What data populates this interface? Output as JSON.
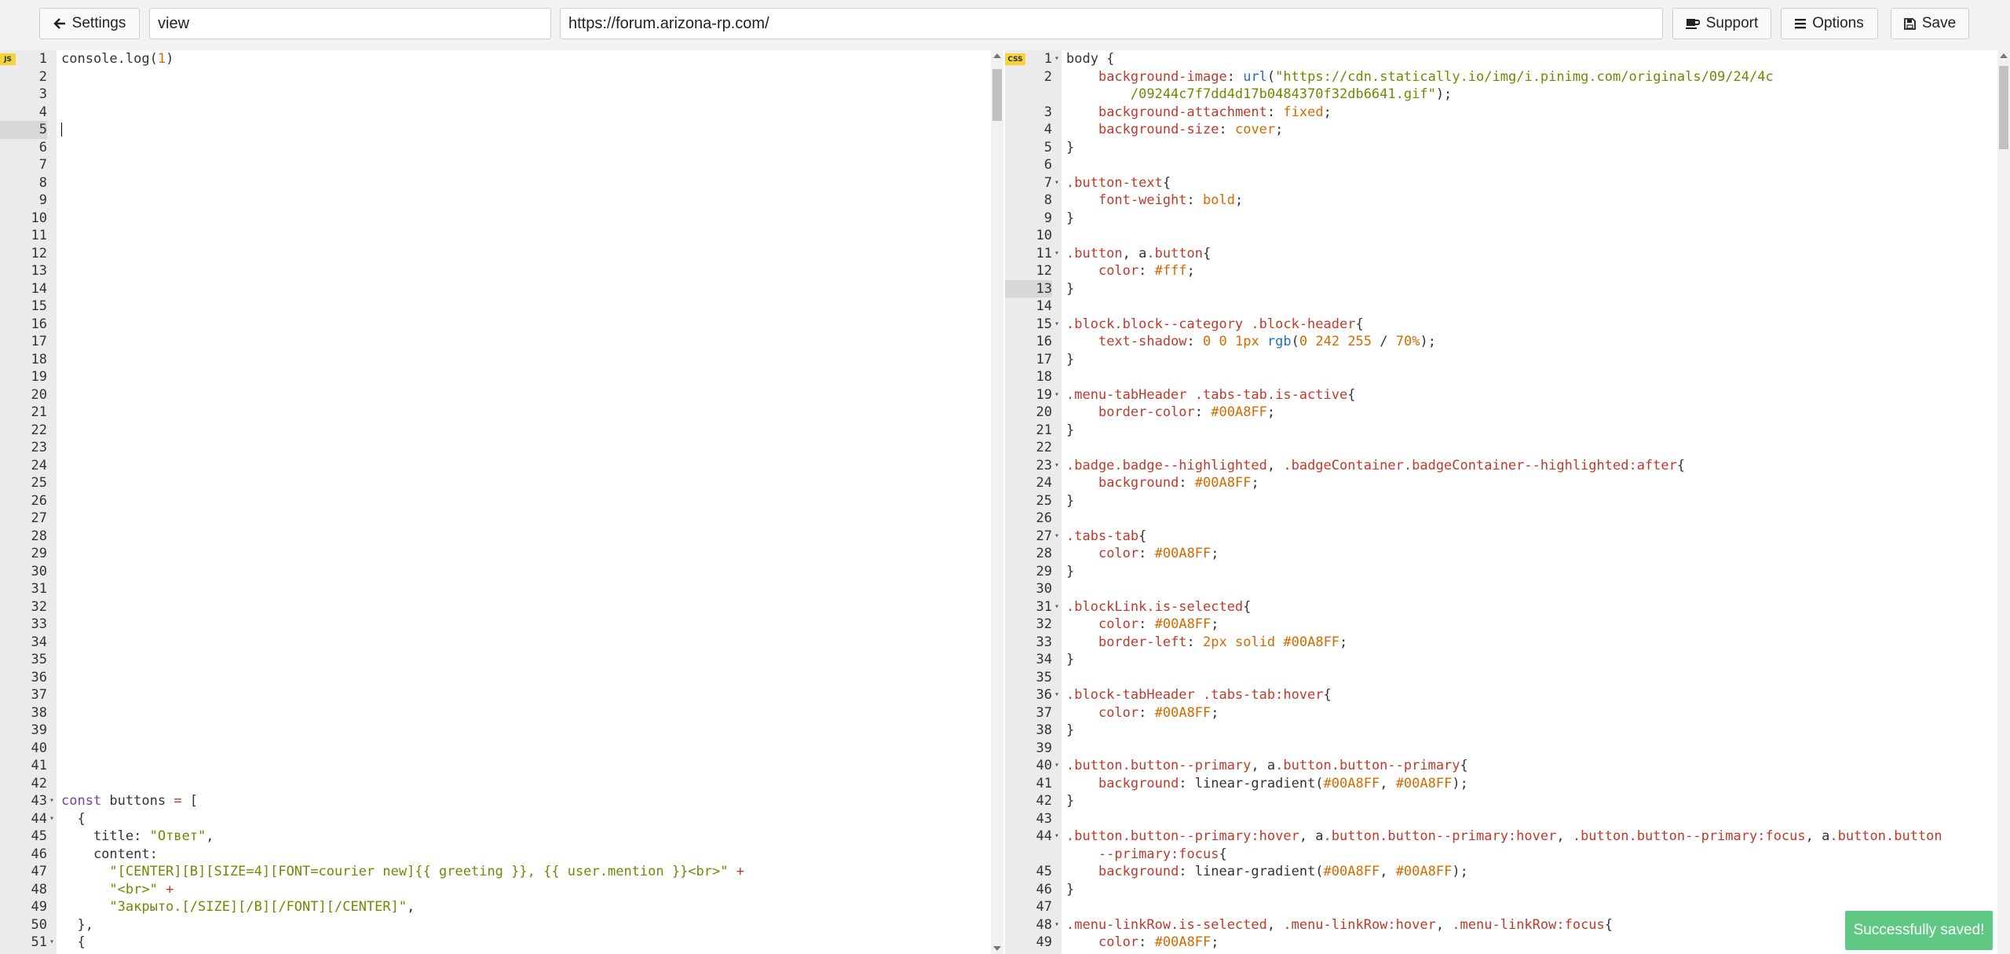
{
  "toolbar": {
    "settings_label": "Settings",
    "view_value": "view",
    "url_value": "https://forum.arizona-rp.com/",
    "support_label": "Support",
    "options_label": "Options",
    "save_label": "Save"
  },
  "js_editor": {
    "badge": "JS",
    "active_line": 5,
    "lines": [
      {
        "n": "1",
        "t": [
          [
            "console.log(",
            "t-plain"
          ],
          [
            "1",
            "t-num"
          ],
          [
            ")",
            "t-plain"
          ]
        ]
      },
      {
        "n": "2",
        "t": []
      },
      {
        "n": "3",
        "t": []
      },
      {
        "n": "4",
        "t": []
      },
      {
        "n": "5",
        "t": [],
        "cursor": true
      },
      {
        "n": "6",
        "t": []
      },
      {
        "n": "7",
        "t": []
      },
      {
        "n": "8",
        "t": []
      },
      {
        "n": "9",
        "t": []
      },
      {
        "n": "10",
        "t": []
      },
      {
        "n": "11",
        "t": []
      },
      {
        "n": "12",
        "t": []
      },
      {
        "n": "13",
        "t": []
      },
      {
        "n": "14",
        "t": []
      },
      {
        "n": "15",
        "t": []
      },
      {
        "n": "16",
        "t": []
      },
      {
        "n": "17",
        "t": []
      },
      {
        "n": "18",
        "t": []
      },
      {
        "n": "19",
        "t": []
      },
      {
        "n": "20",
        "t": []
      },
      {
        "n": "21",
        "t": []
      },
      {
        "n": "22",
        "t": []
      },
      {
        "n": "23",
        "t": []
      },
      {
        "n": "24",
        "t": []
      },
      {
        "n": "25",
        "t": []
      },
      {
        "n": "26",
        "t": []
      },
      {
        "n": "27",
        "t": []
      },
      {
        "n": "28",
        "t": []
      },
      {
        "n": "29",
        "t": []
      },
      {
        "n": "30",
        "t": []
      },
      {
        "n": "31",
        "t": []
      },
      {
        "n": "32",
        "t": []
      },
      {
        "n": "33",
        "t": []
      },
      {
        "n": "34",
        "t": []
      },
      {
        "n": "35",
        "t": []
      },
      {
        "n": "36",
        "t": []
      },
      {
        "n": "37",
        "t": []
      },
      {
        "n": "38",
        "t": []
      },
      {
        "n": "39",
        "t": []
      },
      {
        "n": "40",
        "t": []
      },
      {
        "n": "41",
        "t": []
      },
      {
        "n": "42",
        "t": []
      },
      {
        "n": "43",
        "fold": true,
        "t": [
          [
            "const",
            "t-kw"
          ],
          [
            " buttons ",
            "t-plain"
          ],
          [
            "=",
            "t-op"
          ],
          [
            " [",
            "t-plain"
          ]
        ]
      },
      {
        "n": "44",
        "fold": true,
        "t": [
          [
            "  {",
            "t-plain"
          ]
        ]
      },
      {
        "n": "45",
        "t": [
          [
            "    title: ",
            "t-plain"
          ],
          [
            "\"Ответ\"",
            "t-str"
          ],
          [
            ",",
            "t-plain"
          ]
        ]
      },
      {
        "n": "46",
        "t": [
          [
            "    content:",
            "t-plain"
          ]
        ]
      },
      {
        "n": "47",
        "t": [
          [
            "      \"[CENTER][B][SIZE=4][FONT=courier new]{{ greeting }}, {{ user.mention }}<br>\"",
            "t-str"
          ],
          [
            " +",
            "t-op"
          ]
        ]
      },
      {
        "n": "48",
        "t": [
          [
            "      \"<br>\"",
            "t-str"
          ],
          [
            " +",
            "t-op"
          ]
        ]
      },
      {
        "n": "49",
        "t": [
          [
            "      \"Закрыто.[/SIZE][/B][/FONT][/CENTER]\"",
            "t-str"
          ],
          [
            ",",
            "t-plain"
          ]
        ]
      },
      {
        "n": "50",
        "t": [
          [
            "  },",
            "t-plain"
          ]
        ]
      },
      {
        "n": "51",
        "fold": true,
        "t": [
          [
            "  {",
            "t-plain"
          ]
        ]
      }
    ]
  },
  "css_editor": {
    "badge": "CSS",
    "active_line": 13,
    "lines": [
      {
        "n": "1",
        "fold": true,
        "t": [
          [
            "body {",
            "t-plain"
          ]
        ]
      },
      {
        "n": "2",
        "t": [
          [
            "    ",
            "t-plain"
          ],
          [
            "background-image",
            "t-prop"
          ],
          [
            ": ",
            "t-plain"
          ],
          [
            "url",
            "t-url"
          ],
          [
            "(",
            "t-plain"
          ],
          [
            "\"https://cdn.statically.io/img/i.pinimg.com/originals/09/24/4c",
            "t-str"
          ]
        ]
      },
      {
        "n": "",
        "t": [
          [
            "        /09244c7f7dd4d17b0484370f32db6641.gif\"",
            "t-str"
          ],
          [
            ");",
            "t-plain"
          ]
        ]
      },
      {
        "n": "3",
        "t": [
          [
            "    ",
            "t-plain"
          ],
          [
            "background-attachment",
            "t-prop"
          ],
          [
            ": ",
            "t-plain"
          ],
          [
            "fixed",
            "t-val"
          ],
          [
            ";",
            "t-plain"
          ]
        ]
      },
      {
        "n": "4",
        "t": [
          [
            "    ",
            "t-plain"
          ],
          [
            "background-size",
            "t-prop"
          ],
          [
            ": ",
            "t-plain"
          ],
          [
            "cover",
            "t-val"
          ],
          [
            ";",
            "t-plain"
          ]
        ]
      },
      {
        "n": "5",
        "t": [
          [
            "}",
            "t-plain"
          ]
        ]
      },
      {
        "n": "6",
        "t": []
      },
      {
        "n": "7",
        "fold": true,
        "t": [
          [
            ".button-text",
            "t-sel"
          ],
          [
            "{",
            "t-plain"
          ]
        ]
      },
      {
        "n": "8",
        "t": [
          [
            "    ",
            "t-plain"
          ],
          [
            "font-weight",
            "t-prop"
          ],
          [
            ": ",
            "t-plain"
          ],
          [
            "bold",
            "t-val"
          ],
          [
            ";",
            "t-plain"
          ]
        ]
      },
      {
        "n": "9",
        "t": [
          [
            "}",
            "t-plain"
          ]
        ]
      },
      {
        "n": "10",
        "t": []
      },
      {
        "n": "11",
        "fold": true,
        "t": [
          [
            ".button",
            "t-sel"
          ],
          [
            ", a",
            "t-plain"
          ],
          [
            ".button",
            "t-sel"
          ],
          [
            "{",
            "t-plain"
          ]
        ]
      },
      {
        "n": "12",
        "t": [
          [
            "    ",
            "t-plain"
          ],
          [
            "color",
            "t-prop"
          ],
          [
            ": ",
            "t-plain"
          ],
          [
            "#fff",
            "t-val"
          ],
          [
            ";",
            "t-plain"
          ]
        ]
      },
      {
        "n": "13",
        "t": [
          [
            "}",
            "t-plain"
          ]
        ]
      },
      {
        "n": "14",
        "t": []
      },
      {
        "n": "15",
        "fold": true,
        "t": [
          [
            ".block.block--category .block-header",
            "t-sel"
          ],
          [
            "{",
            "t-plain"
          ]
        ]
      },
      {
        "n": "16",
        "t": [
          [
            "    ",
            "t-plain"
          ],
          [
            "text-shadow",
            "t-prop"
          ],
          [
            ": ",
            "t-plain"
          ],
          [
            "0 0 1",
            "t-num"
          ],
          [
            "px ",
            "t-val"
          ],
          [
            "rgb",
            "t-url"
          ],
          [
            "(",
            "t-plain"
          ],
          [
            "0 242 255",
            "t-num"
          ],
          [
            " / ",
            "t-plain"
          ],
          [
            "70",
            "t-num"
          ],
          [
            "%",
            "t-val"
          ],
          [
            ");",
            "t-plain"
          ]
        ]
      },
      {
        "n": "17",
        "t": [
          [
            "}",
            "t-plain"
          ]
        ]
      },
      {
        "n": "18",
        "t": []
      },
      {
        "n": "19",
        "fold": true,
        "t": [
          [
            ".menu-tabHeader .tabs-tab.is-active",
            "t-sel"
          ],
          [
            "{",
            "t-plain"
          ]
        ]
      },
      {
        "n": "20",
        "t": [
          [
            "    ",
            "t-plain"
          ],
          [
            "border-color",
            "t-prop"
          ],
          [
            ": ",
            "t-plain"
          ],
          [
            "#00A8FF",
            "t-val"
          ],
          [
            ";",
            "t-plain"
          ]
        ]
      },
      {
        "n": "21",
        "t": [
          [
            "}",
            "t-plain"
          ]
        ]
      },
      {
        "n": "22",
        "t": []
      },
      {
        "n": "23",
        "fold": true,
        "t": [
          [
            ".badge.badge--highlighted",
            "t-sel"
          ],
          [
            ", ",
            "t-plain"
          ],
          [
            ".badgeContainer.badgeContainer--highlighted:after",
            "t-sel"
          ],
          [
            "{",
            "t-plain"
          ]
        ]
      },
      {
        "n": "24",
        "t": [
          [
            "    ",
            "t-plain"
          ],
          [
            "background",
            "t-prop"
          ],
          [
            ": ",
            "t-plain"
          ],
          [
            "#00A8FF",
            "t-val"
          ],
          [
            ";",
            "t-plain"
          ]
        ]
      },
      {
        "n": "25",
        "t": [
          [
            "}",
            "t-plain"
          ]
        ]
      },
      {
        "n": "26",
        "t": []
      },
      {
        "n": "27",
        "fold": true,
        "t": [
          [
            ".tabs-tab",
            "t-sel"
          ],
          [
            "{",
            "t-plain"
          ]
        ]
      },
      {
        "n": "28",
        "t": [
          [
            "    ",
            "t-plain"
          ],
          [
            "color",
            "t-prop"
          ],
          [
            ": ",
            "t-plain"
          ],
          [
            "#00A8FF",
            "t-val"
          ],
          [
            ";",
            "t-plain"
          ]
        ]
      },
      {
        "n": "29",
        "t": [
          [
            "}",
            "t-plain"
          ]
        ]
      },
      {
        "n": "30",
        "t": []
      },
      {
        "n": "31",
        "fold": true,
        "t": [
          [
            ".blockLink.is-selected",
            "t-sel"
          ],
          [
            "{",
            "t-plain"
          ]
        ]
      },
      {
        "n": "32",
        "t": [
          [
            "    ",
            "t-plain"
          ],
          [
            "color",
            "t-prop"
          ],
          [
            ": ",
            "t-plain"
          ],
          [
            "#00A8FF",
            "t-val"
          ],
          [
            ";",
            "t-plain"
          ]
        ]
      },
      {
        "n": "33",
        "t": [
          [
            "    ",
            "t-plain"
          ],
          [
            "border-left",
            "t-prop"
          ],
          [
            ": ",
            "t-plain"
          ],
          [
            "2",
            "t-num"
          ],
          [
            "px solid #00A8FF",
            "t-val"
          ],
          [
            ";",
            "t-plain"
          ]
        ]
      },
      {
        "n": "34",
        "t": [
          [
            "}",
            "t-plain"
          ]
        ]
      },
      {
        "n": "35",
        "t": []
      },
      {
        "n": "36",
        "fold": true,
        "t": [
          [
            ".block-tabHeader .tabs-tab:hover",
            "t-sel"
          ],
          [
            "{",
            "t-plain"
          ]
        ]
      },
      {
        "n": "37",
        "t": [
          [
            "    ",
            "t-plain"
          ],
          [
            "color",
            "t-prop"
          ],
          [
            ": ",
            "t-plain"
          ],
          [
            "#00A8FF",
            "t-val"
          ],
          [
            ";",
            "t-plain"
          ]
        ]
      },
      {
        "n": "38",
        "t": [
          [
            "}",
            "t-plain"
          ]
        ]
      },
      {
        "n": "39",
        "t": []
      },
      {
        "n": "40",
        "fold": true,
        "t": [
          [
            ".button.button--primary",
            "t-sel"
          ],
          [
            ", a",
            "t-plain"
          ],
          [
            ".button.button--primary",
            "t-sel"
          ],
          [
            "{",
            "t-plain"
          ]
        ]
      },
      {
        "n": "41",
        "t": [
          [
            "    ",
            "t-plain"
          ],
          [
            "background",
            "t-prop"
          ],
          [
            ": linear-gradient(",
            "t-plain"
          ],
          [
            "#00A8FF",
            "t-val"
          ],
          [
            ", ",
            "t-plain"
          ],
          [
            "#00A8FF",
            "t-val"
          ],
          [
            ");",
            "t-plain"
          ]
        ]
      },
      {
        "n": "42",
        "t": [
          [
            "}",
            "t-plain"
          ]
        ]
      },
      {
        "n": "43",
        "t": []
      },
      {
        "n": "44",
        "fold": true,
        "t": [
          [
            ".button.button--primary:hover",
            "t-sel"
          ],
          [
            ", a",
            "t-plain"
          ],
          [
            ".button.button--primary:hover",
            "t-sel"
          ],
          [
            ", ",
            "t-plain"
          ],
          [
            ".button.button--primary:focus",
            "t-sel"
          ],
          [
            ", a",
            "t-plain"
          ],
          [
            ".button.button",
            "t-sel"
          ]
        ]
      },
      {
        "n": "",
        "t": [
          [
            "    --primary:focus",
            "t-sel"
          ],
          [
            "{",
            "t-plain"
          ]
        ]
      },
      {
        "n": "45",
        "t": [
          [
            "    ",
            "t-plain"
          ],
          [
            "background",
            "t-prop"
          ],
          [
            ": linear-gradient(",
            "t-plain"
          ],
          [
            "#00A8FF",
            "t-val"
          ],
          [
            ", ",
            "t-plain"
          ],
          [
            "#00A8FF",
            "t-val"
          ],
          [
            ");",
            "t-plain"
          ]
        ]
      },
      {
        "n": "46",
        "t": [
          [
            "}",
            "t-plain"
          ]
        ]
      },
      {
        "n": "47",
        "t": []
      },
      {
        "n": "48",
        "fold": true,
        "t": [
          [
            ".menu-linkRow.is-selected",
            "t-sel"
          ],
          [
            ", ",
            "t-plain"
          ],
          [
            ".menu-linkRow:hover",
            "t-sel"
          ],
          [
            ", ",
            "t-plain"
          ],
          [
            ".menu-linkRow:focus",
            "t-sel"
          ],
          [
            "{",
            "t-plain"
          ]
        ]
      },
      {
        "n": "49",
        "t": [
          [
            "    ",
            "t-plain"
          ],
          [
            "color",
            "t-prop"
          ],
          [
            ": ",
            "t-plain"
          ],
          [
            "#00A8FF",
            "t-val"
          ],
          [
            ";",
            "t-plain"
          ]
        ]
      }
    ]
  },
  "toast": {
    "text": "Successfully saved!"
  },
  "colors": {
    "toast_bg": "#5fc983",
    "badge_bg": "#f5d33d",
    "gutter_bg": "#ebebeb"
  }
}
